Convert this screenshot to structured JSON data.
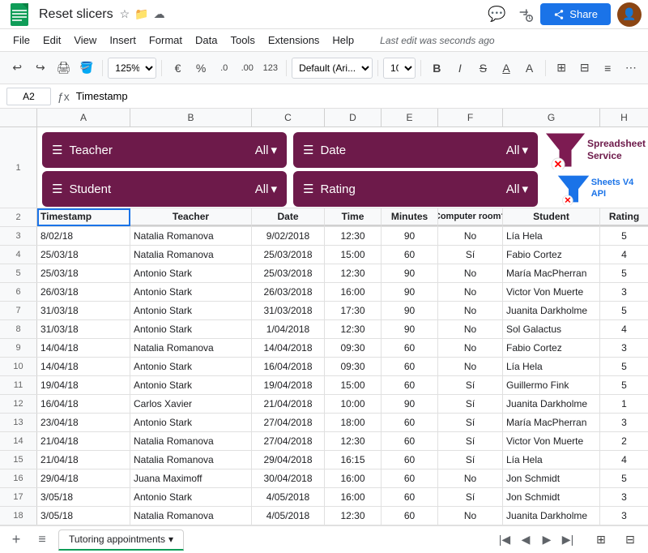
{
  "titleBar": {
    "title": "Reset slicers",
    "menuItems": [
      "File",
      "Edit",
      "View",
      "Insert",
      "Format",
      "Data",
      "Tools",
      "Extensions",
      "Help"
    ],
    "lastEdit": "Last edit was seconds ago",
    "shareLabel": "Share"
  },
  "toolbar": {
    "zoom": "125%",
    "currency": "€",
    "percent": "%",
    "decimal1": ".0",
    "decimal2": ".00",
    "decimal3": "123",
    "font": "Default (Ari...)",
    "fontSize": "10"
  },
  "formulaBar": {
    "cellRef": "A2",
    "formula": "Timestamp"
  },
  "columns": {
    "headers": [
      "A",
      "B",
      "C",
      "D",
      "E",
      "F",
      "G",
      "H"
    ]
  },
  "slicers": {
    "row1": [
      {
        "label": "Teacher",
        "value": "All"
      },
      {
        "label": "Date",
        "value": "All"
      }
    ],
    "row2": [
      {
        "label": "Student",
        "value": "All"
      },
      {
        "label": "Rating",
        "value": "All"
      }
    ]
  },
  "ssWidget": {
    "line1": "Spreadsheet",
    "line2": "Service",
    "line3": "Sheets V4",
    "line4": "API"
  },
  "tableHeaders": {
    "col1": "Timestamp",
    "col2": "Teacher",
    "col3": "Date",
    "col4": "Time",
    "col5": "Minutes",
    "col6": "Computer room?",
    "col7": "Student",
    "col8": "Rating"
  },
  "rows": [
    {
      "num": 3,
      "timestamp": "8/02/18",
      "teacher": "Natalia Romanova",
      "date": "9/02/2018",
      "time": "12:30",
      "minutes": "90",
      "computer": "No",
      "student": "Lía Hela",
      "rating": "5"
    },
    {
      "num": 4,
      "timestamp": "25/03/18",
      "teacher": "Natalia Romanova",
      "date": "25/03/2018",
      "time": "15:00",
      "minutes": "60",
      "computer": "Sí",
      "student": "Fabio Cortez",
      "rating": "4"
    },
    {
      "num": 5,
      "timestamp": "25/03/18",
      "teacher": "Antonio Stark",
      "date": "25/03/2018",
      "time": "12:30",
      "minutes": "90",
      "computer": "No",
      "student": "María MacPherran",
      "rating": "5"
    },
    {
      "num": 6,
      "timestamp": "26/03/18",
      "teacher": "Antonio Stark",
      "date": "26/03/2018",
      "time": "16:00",
      "minutes": "90",
      "computer": "No",
      "student": "Victor Von Muerte",
      "rating": "3"
    },
    {
      "num": 7,
      "timestamp": "31/03/18",
      "teacher": "Antonio Stark",
      "date": "31/03/2018",
      "time": "17:30",
      "minutes": "90",
      "computer": "No",
      "student": "Juanita Darkholme",
      "rating": "5"
    },
    {
      "num": 8,
      "timestamp": "31/03/18",
      "teacher": "Antonio Stark",
      "date": "1/04/2018",
      "time": "12:30",
      "minutes": "90",
      "computer": "No",
      "student": "Sol Galactus",
      "rating": "4"
    },
    {
      "num": 9,
      "timestamp": "14/04/18",
      "teacher": "Natalia Romanova",
      "date": "14/04/2018",
      "time": "09:30",
      "minutes": "60",
      "computer": "No",
      "student": "Fabio Cortez",
      "rating": "3"
    },
    {
      "num": 10,
      "timestamp": "14/04/18",
      "teacher": "Antonio Stark",
      "date": "16/04/2018",
      "time": "09:30",
      "minutes": "60",
      "computer": "No",
      "student": "Lía Hela",
      "rating": "5"
    },
    {
      "num": 11,
      "timestamp": "19/04/18",
      "teacher": "Antonio Stark",
      "date": "19/04/2018",
      "time": "15:00",
      "minutes": "60",
      "computer": "Sí",
      "student": "Guillermo Fink",
      "rating": "5"
    },
    {
      "num": 12,
      "timestamp": "16/04/18",
      "teacher": "Carlos Xavier",
      "date": "21/04/2018",
      "time": "10:00",
      "minutes": "90",
      "computer": "Sí",
      "student": "Juanita Darkholme",
      "rating": "1"
    },
    {
      "num": 13,
      "timestamp": "23/04/18",
      "teacher": "Antonio Stark",
      "date": "27/04/2018",
      "time": "18:00",
      "minutes": "60",
      "computer": "Sí",
      "student": "María MacPherran",
      "rating": "3"
    },
    {
      "num": 14,
      "timestamp": "21/04/18",
      "teacher": "Natalia Romanova",
      "date": "27/04/2018",
      "time": "12:30",
      "minutes": "60",
      "computer": "Sí",
      "student": "Victor Von Muerte",
      "rating": "2"
    },
    {
      "num": 15,
      "timestamp": "21/04/18",
      "teacher": "Natalia Romanova",
      "date": "29/04/2018",
      "time": "16:15",
      "minutes": "60",
      "computer": "Sí",
      "student": "Lía Hela",
      "rating": "4"
    },
    {
      "num": 16,
      "timestamp": "29/04/18",
      "teacher": "Juana Maximoff",
      "date": "30/04/2018",
      "time": "16:00",
      "minutes": "60",
      "computer": "No",
      "student": "Jon Schmidt",
      "rating": "5"
    },
    {
      "num": 17,
      "timestamp": "3/05/18",
      "teacher": "Antonio Stark",
      "date": "4/05/2018",
      "time": "16:00",
      "minutes": "60",
      "computer": "Sí",
      "student": "Jon Schmidt",
      "rating": "3"
    },
    {
      "num": 18,
      "timestamp": "3/05/18",
      "teacher": "Natalia Romanova",
      "date": "4/05/2018",
      "time": "12:30",
      "minutes": "60",
      "computer": "No",
      "student": "Juanita Darkholme",
      "rating": "3"
    }
  ],
  "sheetTab": {
    "name": "Tutoring appointments"
  }
}
